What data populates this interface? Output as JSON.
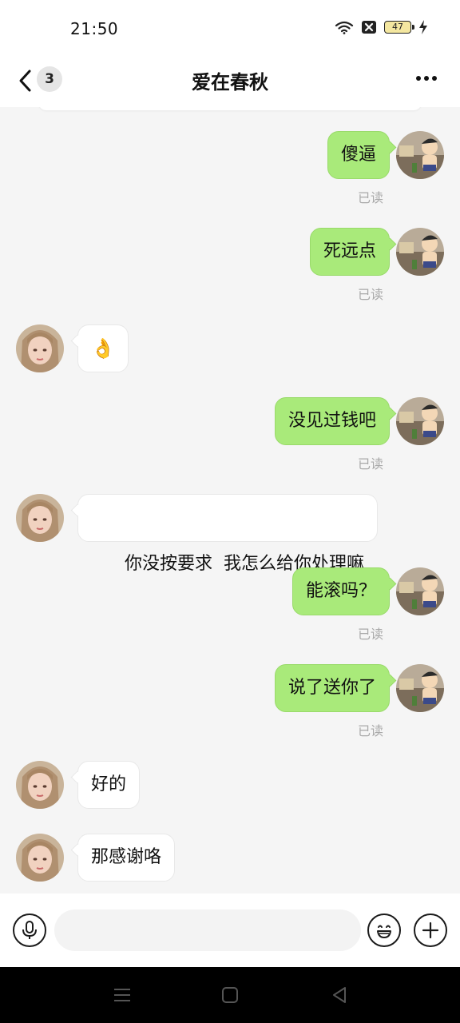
{
  "status_bar": {
    "time": "21:50",
    "battery_level": "47",
    "icons": [
      "wifi-icon",
      "x-notification-icon",
      "battery-icon",
      "charging-icon"
    ]
  },
  "header": {
    "back_icon": "chevron-left-icon",
    "unread_count": "3",
    "title": "爱在春秋",
    "more_icon": "ellipsis-icon"
  },
  "messages": [
    {
      "direction": "sent",
      "text": "傻逼",
      "read": "已读"
    },
    {
      "direction": "sent",
      "text": "死远点",
      "read": "已读"
    },
    {
      "direction": "received",
      "emoji": "👌"
    },
    {
      "direction": "sent",
      "text": "没见过钱吧",
      "read": "已读"
    },
    {
      "direction": "received",
      "text": "你没按要求  我怎么给你处理嘛"
    },
    {
      "direction": "sent",
      "text": "能滚吗？",
      "read": "已读"
    },
    {
      "direction": "sent",
      "text": "说了送你了",
      "read": "已读"
    },
    {
      "direction": "received",
      "text": "好的"
    },
    {
      "direction": "received",
      "text": "那感谢咯"
    }
  ],
  "input_bar": {
    "voice_icon": "microphone-icon",
    "input_value": "",
    "emoji_icon": "smiley-face-icon",
    "plus_icon": "plus-icon"
  },
  "nav_bar": {
    "icons": [
      "menu-icon",
      "home-square-icon",
      "back-triangle-icon"
    ]
  },
  "colors": {
    "sent_bubble": "#a9ea7a",
    "received_bubble": "#ffffff",
    "chat_background": "#f5f5f5",
    "read_label": "#a9a9a9",
    "nav_bar": "#000000"
  }
}
